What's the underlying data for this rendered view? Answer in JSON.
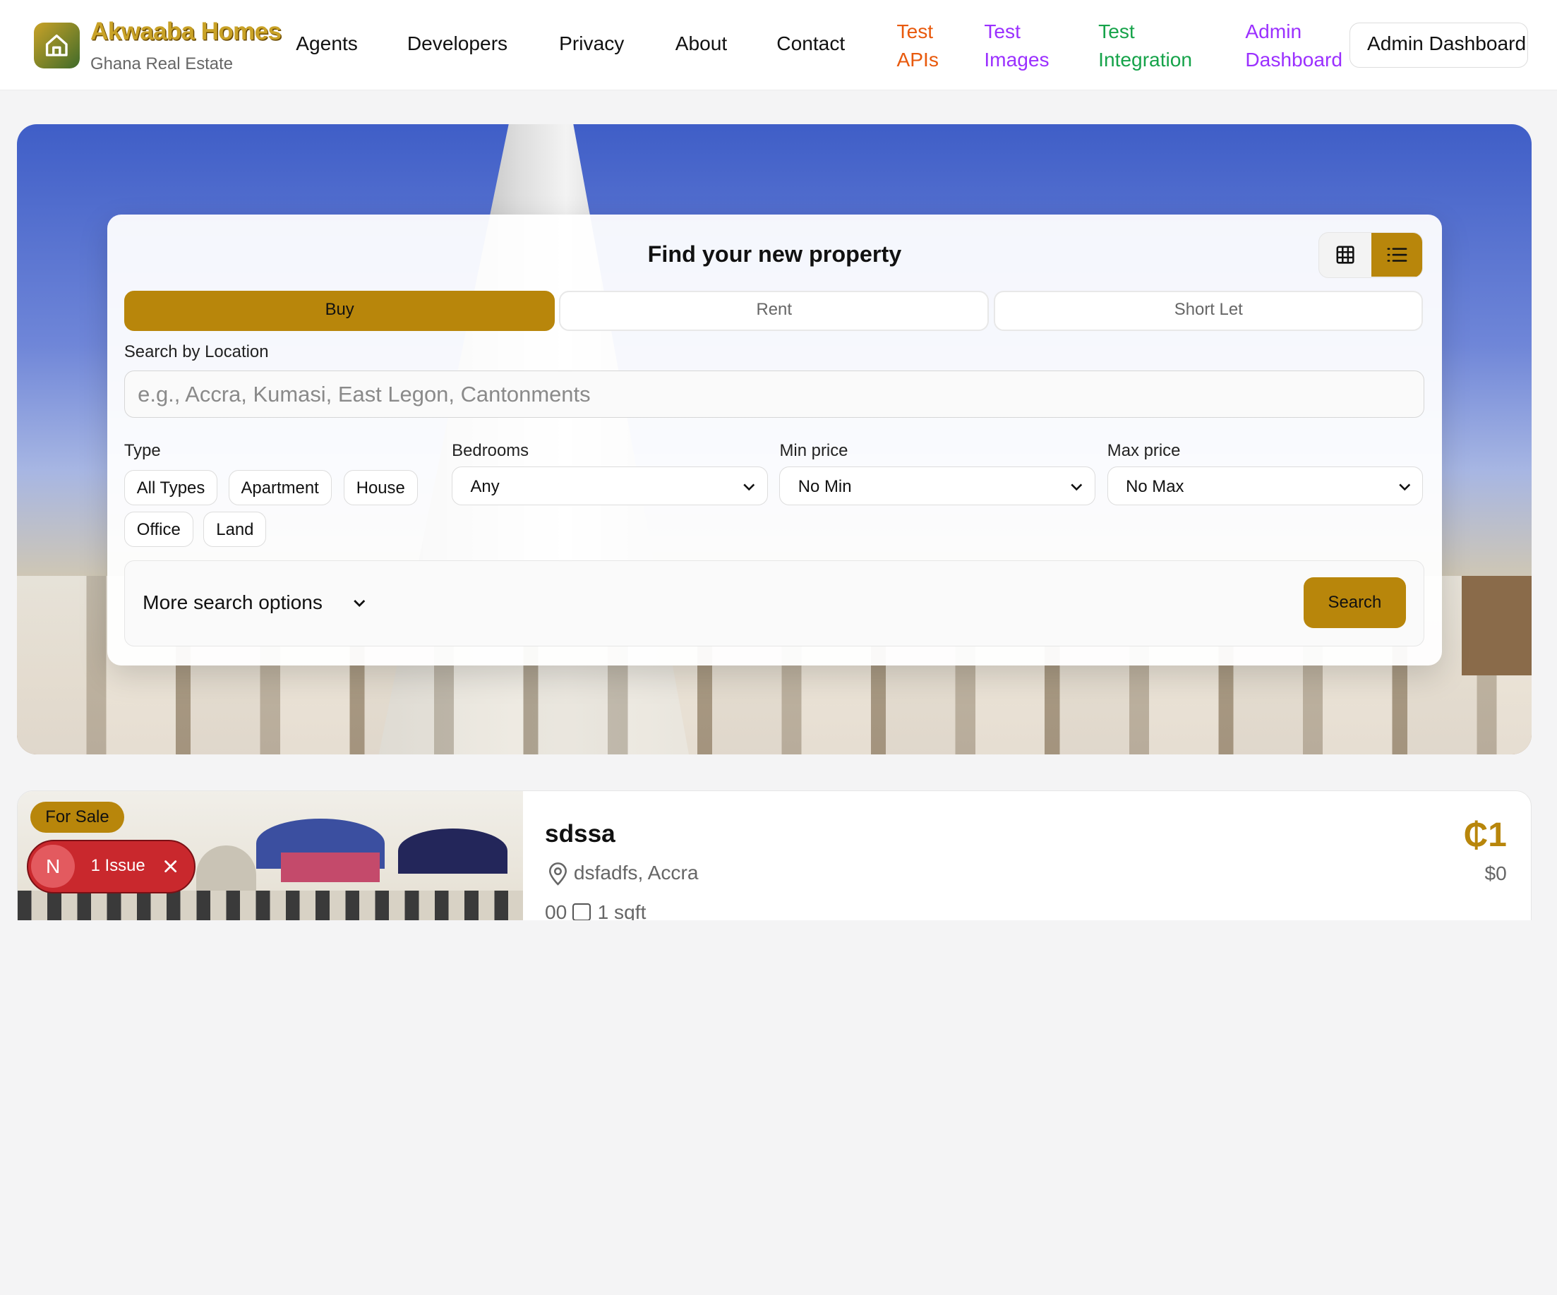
{
  "brand": {
    "title": "Akwaaba Homes",
    "subtitle": "Ghana Real Estate"
  },
  "nav": {
    "agents": "Agents",
    "developers": "Developers",
    "privacy": "Privacy",
    "about": "About",
    "contact": "Contact",
    "test_apis_1": "Test",
    "test_apis_2": "APIs",
    "test_images_1": "Test",
    "test_images_2": "Images",
    "test_integration_1": "Test",
    "test_integration_2": "Integration",
    "admin_dashboard_1": "Admin",
    "admin_dashboard_2": "Dashboard",
    "admin_button": "Admin Dashboard"
  },
  "colors": {
    "accent": "#b8860b",
    "test_apis": "#e8590c",
    "test_images": "#9b30ff",
    "test_integration": "#16a34a",
    "admin_dashboard": "#9b30ff"
  },
  "search": {
    "title": "Find your new property",
    "tabs": [
      "Buy",
      "Rent",
      "Short Let"
    ],
    "active_tab": "Buy",
    "location_label": "Search by Location",
    "location_placeholder": "e.g., Accra, Kumasi, East Legon, Cantonments",
    "type_label": "Type",
    "types": [
      "All Types",
      "Apartment",
      "House",
      "Office",
      "Land"
    ],
    "bedrooms_label": "Bedrooms",
    "bedrooms_value": "Any",
    "min_price_label": "Min price",
    "min_price_value": "No Min",
    "max_price_label": "Max price",
    "max_price_value": "No Max",
    "more_options": "More search options",
    "search_button": "Search",
    "view_modes": [
      "grid-icon",
      "list-icon"
    ],
    "active_view": "list"
  },
  "listing": {
    "badge": "For Sale",
    "title": "sdssa",
    "location": "dsfadfs, Accra",
    "price": "₵1",
    "price_usd": "$0",
    "beds_baths": "00",
    "size": "1 sqft"
  },
  "issue_badge": {
    "letter": "N",
    "text": "1 Issue"
  }
}
